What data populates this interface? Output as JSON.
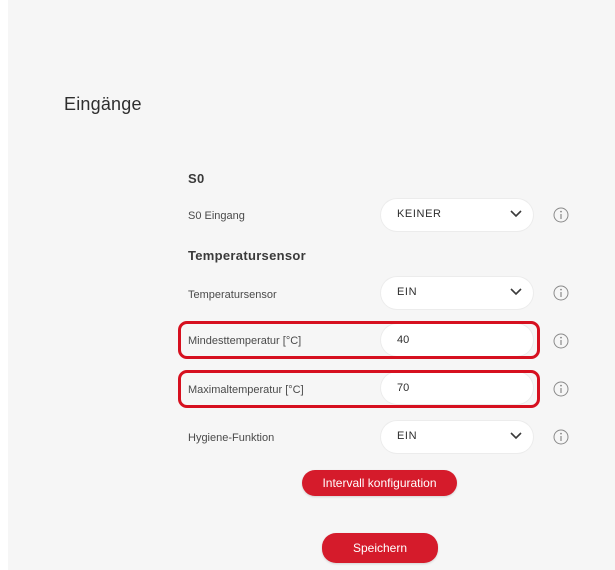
{
  "page": {
    "title": "Eingänge"
  },
  "s0": {
    "section_title": "S0",
    "input_label": "S0 Eingang",
    "input_value": "KEINER"
  },
  "temperature": {
    "section_title": "Temperatursensor",
    "sensor_label": "Temperatursensor",
    "sensor_value": "EIN",
    "min_label": "Mindesttemperatur [°C]",
    "min_value": "40",
    "max_label": "Maximaltemperatur [°C]",
    "max_value": "70",
    "hygiene_label": "Hygiene-Funktion",
    "hygiene_value": "EIN"
  },
  "buttons": {
    "interval_label": "Intervall konfiguration",
    "save_label": "Speichern"
  },
  "colors": {
    "accent": "#d51b2b",
    "highlight": "#d6101f",
    "background": "#f6f6f6"
  },
  "icons": {
    "dropdown": "chevron-down-icon",
    "info": "info-icon"
  }
}
